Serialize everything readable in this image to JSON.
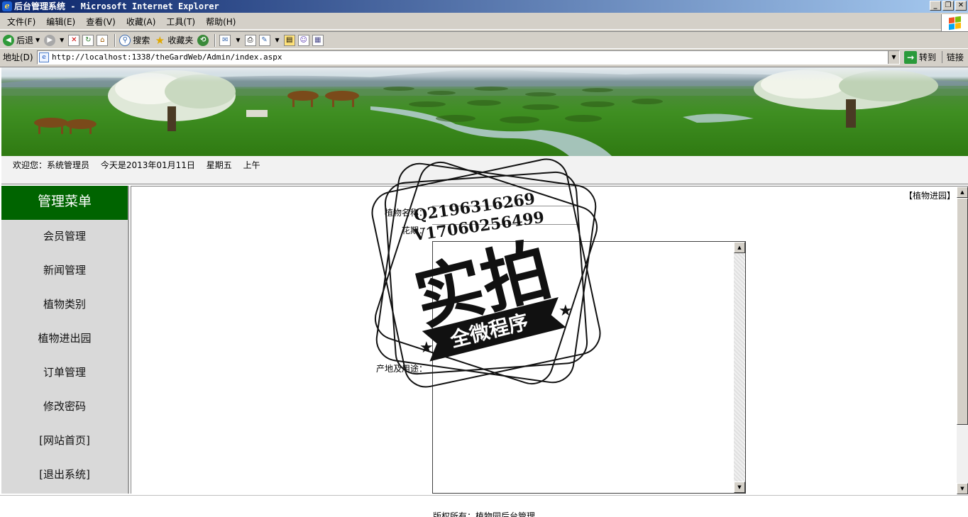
{
  "window": {
    "title": "后台管理系统 - Microsoft Internet Explorer",
    "min": "_",
    "max": "❐",
    "close": "✕"
  },
  "menu": {
    "items": [
      "文件(F)",
      "编辑(E)",
      "查看(V)",
      "收藏(A)",
      "工具(T)",
      "帮助(H)"
    ]
  },
  "toolbar": {
    "back": "后退",
    "search": "搜索",
    "favorites": "收藏夹"
  },
  "address": {
    "label": "地址(D)",
    "url": "http://localhost:1338/theGardWeb/Admin/index.aspx",
    "go": "转到",
    "links": "链接"
  },
  "welcome": {
    "greeting": "欢迎您：系统管理员",
    "date": "今天是2013年01月11日",
    "weekday": "星期五",
    "period": "上午"
  },
  "sidebar": {
    "title": "管理菜单",
    "items": [
      "会员管理",
      "新闻管理",
      "植物类别",
      "植物进出园",
      "订单管理",
      "修改密码",
      "[网站首页]",
      "[退出系统]"
    ]
  },
  "main": {
    "breadcrumb": "【植物进园】",
    "fields": {
      "name_label": "植物名称：",
      "bloom_label": "花期：",
      "origin_label": "产地及用途："
    }
  },
  "footer": {
    "copyright": "版权所有：植物园后台管理"
  },
  "stamp": {
    "q": "Q2196316269",
    "v": "V17060256499",
    "main": "实拍",
    "ribbon": "全微程序"
  }
}
